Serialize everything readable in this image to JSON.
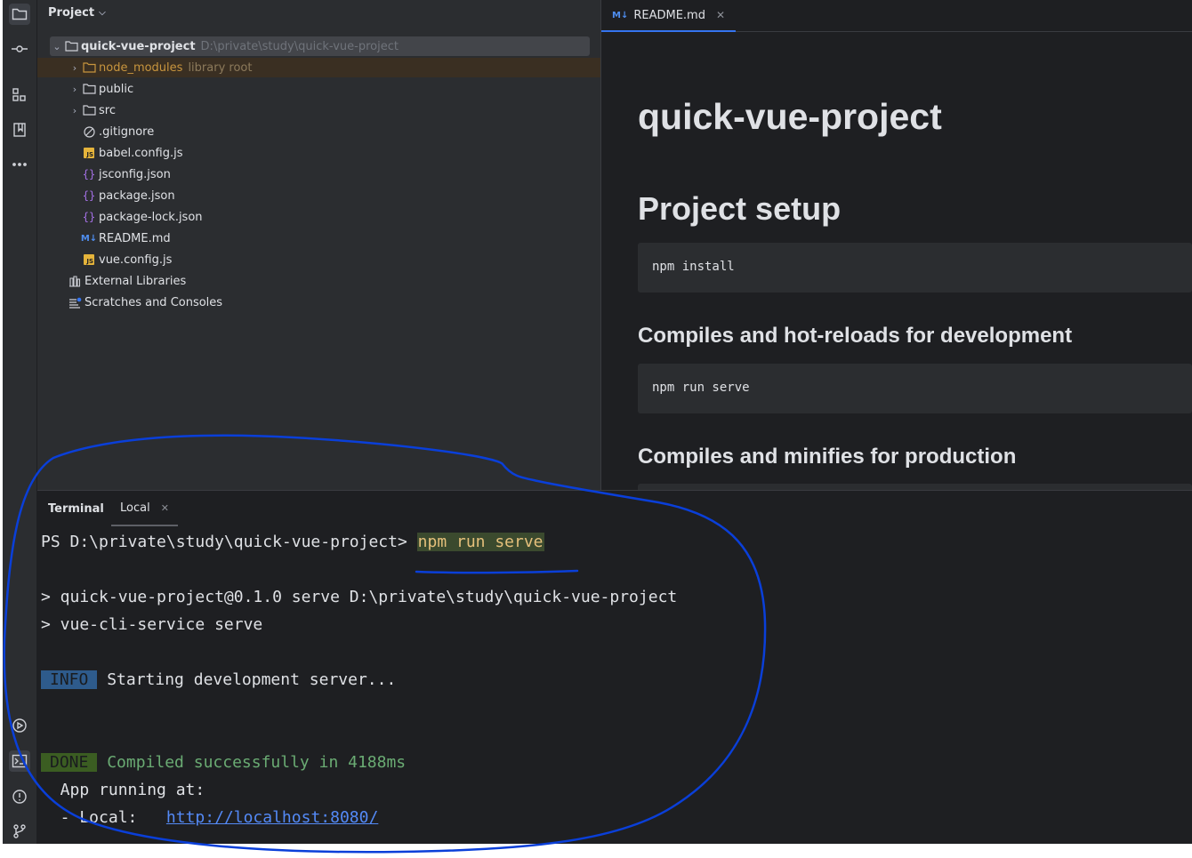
{
  "project_panel": {
    "title": "Project",
    "tree": [
      {
        "name": "quick-vue-project",
        "hint": "D:\\private\\study\\quick-vue-project"
      },
      {
        "name": "node_modules",
        "hint": "library root"
      },
      {
        "name": "public"
      },
      {
        "name": "src"
      },
      {
        "name": ".gitignore"
      },
      {
        "name": "babel.config.js"
      },
      {
        "name": "jsconfig.json"
      },
      {
        "name": "package.json"
      },
      {
        "name": "package-lock.json"
      },
      {
        "name": "README.md"
      },
      {
        "name": "vue.config.js"
      },
      {
        "name": "External Libraries"
      },
      {
        "name": "Scratches and Consoles"
      }
    ]
  },
  "editor": {
    "tab_label": "README.md",
    "tab_icon_text": "M↓",
    "h1": "quick-vue-project",
    "h2": "Project setup",
    "code1": "npm install",
    "h3_dev": "Compiles and hot-reloads for development",
    "code2": "npm run serve",
    "h3_prod": "Compiles and minifies for production"
  },
  "terminal": {
    "title": "Terminal",
    "tab_label": "Local",
    "prompt": "PS D:\\private\\study\\quick-vue-project> ",
    "command": "npm run serve",
    "line1": "> quick-vue-project@0.1.0 serve D:\\private\\study\\quick-vue-project",
    "line2": "> vue-cli-service serve",
    "info_badge": "INFO",
    "info_text": " Starting development server...",
    "done_badge": "DONE",
    "done_text": " Compiled successfully in 4188ms",
    "running": "  App running at:",
    "local_prefix": "  - Local:   ",
    "local_url": "http://localhost:8080/"
  },
  "icons": {
    "strip_top": [
      "folder-icon",
      "commit-icon",
      "structure-icon",
      "bookmarks-icon",
      "more-icon"
    ],
    "strip_bottom": [
      "run-icon",
      "terminal-icon",
      "problems-icon",
      "git-icon"
    ]
  },
  "colors": {
    "annotation": "#0a3fd9",
    "accent": "#3574f0"
  }
}
